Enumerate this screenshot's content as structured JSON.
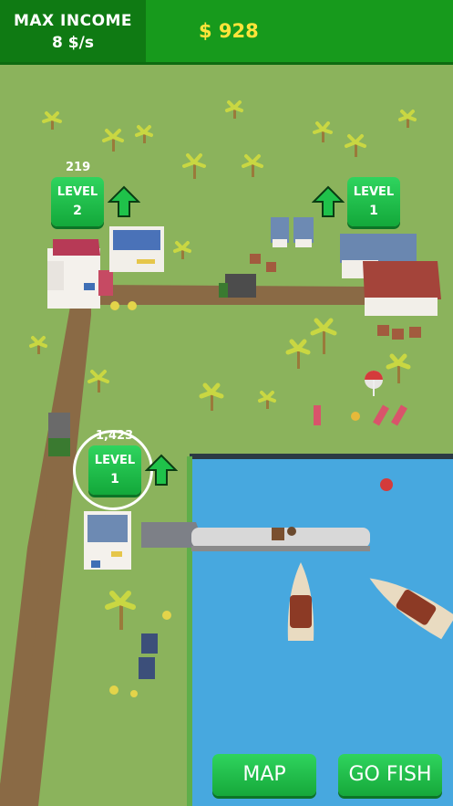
{
  "hud": {
    "income_label": "MAX INCOME",
    "income_value": "8 $/s",
    "money": "$ 928"
  },
  "buildings": [
    {
      "price": "219",
      "level_label": "LEVEL",
      "level_value": "2"
    },
    {
      "level_label": "LEVEL",
      "level_value": "1"
    },
    {
      "price": "1,423",
      "level_label": "LEVEL",
      "level_value": "1"
    }
  ],
  "buttons": {
    "map": "MAP",
    "go_fish": "GO FISH"
  },
  "colors": {
    "grass": "#8bb35c",
    "water": "#47a8df",
    "road": "#8a6a45",
    "hud_green": "#179a1c",
    "button_green": "#22c14a",
    "money_yellow": "#ffe43a"
  }
}
